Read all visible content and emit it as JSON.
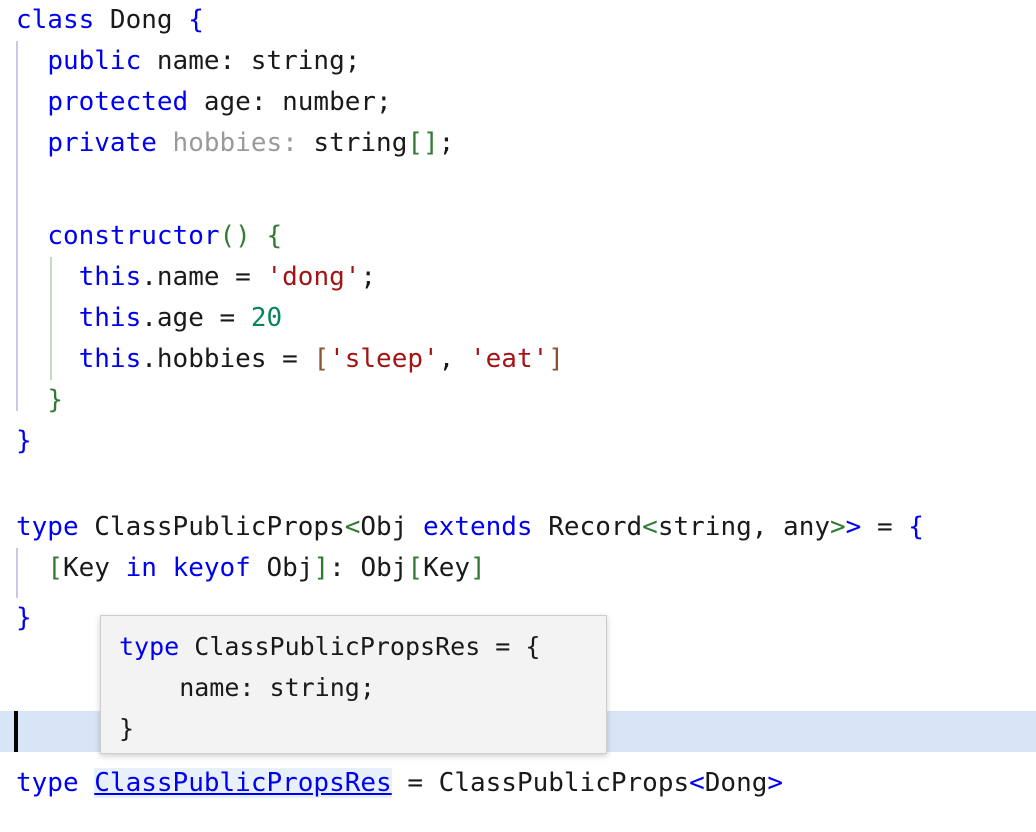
{
  "editor": {
    "language": "typescript",
    "background": "#ffffff",
    "current_line_highlight": "#d7e5f7",
    "caret_color": "#000000",
    "colors": {
      "keyword": "#0000f0",
      "plain": "#1a1a1a",
      "unused": "#9a9a9a",
      "string": "#a31515",
      "number": "#098658",
      "bracket_green": "#327a32",
      "bracket_blue": "#0000f0",
      "bracket_brown": "#8a5430",
      "reference_link": "#0000f0",
      "selection": "#e8f0fb",
      "indent_guide_outer": "#c8c8e8",
      "indent_guide_inner": "#c2dcc2"
    }
  },
  "code": {
    "line1": {
      "kw_class": "class",
      "name": " Dong ",
      "brace": "{"
    },
    "line2": {
      "indent": "  ",
      "kw": "public",
      "rest": " name: string;"
    },
    "line3": {
      "indent": "  ",
      "kw": "protected",
      "rest": " age: number;"
    },
    "line4": {
      "indent": "  ",
      "kw": "private",
      "space": " ",
      "unused": "hobbies:",
      "type": " string",
      "brackets": "[]",
      "semi": ";"
    },
    "line6": {
      "indent": "  ",
      "name": "constructor",
      "parens": "()",
      "space": " ",
      "brace": "{"
    },
    "line7": {
      "indent": "    ",
      "kw_this": "this",
      "prop": ".name = ",
      "string": "'dong'",
      "semi": ";"
    },
    "line8": {
      "indent": "    ",
      "kw_this": "this",
      "prop": ".age = ",
      "number": "20"
    },
    "line9": {
      "indent": "    ",
      "kw_this": "this",
      "prop": ".hobbies = ",
      "open_bracket": "[",
      "string1": "'sleep'",
      "comma": ", ",
      "string2": "'eat'",
      "close_bracket": "]"
    },
    "line10": {
      "indent": "  ",
      "brace": "}"
    },
    "line11": {
      "brace": "}"
    },
    "line13": {
      "kw_type": "type",
      "name": " ClassPublicProps",
      "lt1": "<",
      "obj": "Obj ",
      "kw_extends": "extends",
      "record": " Record",
      "lt2": "<",
      "generic_args": "string, any",
      "gt2": ">",
      "gt1": ">",
      "eq": " = ",
      "brace": "{"
    },
    "line14": {
      "indent": "  ",
      "open_bracket": "[",
      "key": "Key ",
      "kw_in": "in",
      "space": " ",
      "kw_keyof": "keyof",
      "obj": " Obj",
      "close_bracket": "]",
      "colon": ": ",
      "obj2": "Obj",
      "open_bracket2": "[",
      "key2": "Key",
      "close_bracket2": "]"
    },
    "line15": {
      "brace": "}"
    },
    "line17": {
      "is_current_line": true,
      "content": ""
    },
    "line18": {
      "kw_type": "type",
      "space": " ",
      "reference": "ClassPublicPropsRes",
      "eq": " = ",
      "generic_name": "ClassPublicProps",
      "lt": "<",
      "arg": "Dong",
      "gt": ">"
    }
  },
  "tooltip": {
    "visible": true,
    "background": "#f3f3f3",
    "border_color": "#cdcdcd",
    "line1_kw": "type",
    "line1_rest": " ClassPublicPropsRes = {",
    "line2": "    name: string;",
    "line3": "}"
  }
}
